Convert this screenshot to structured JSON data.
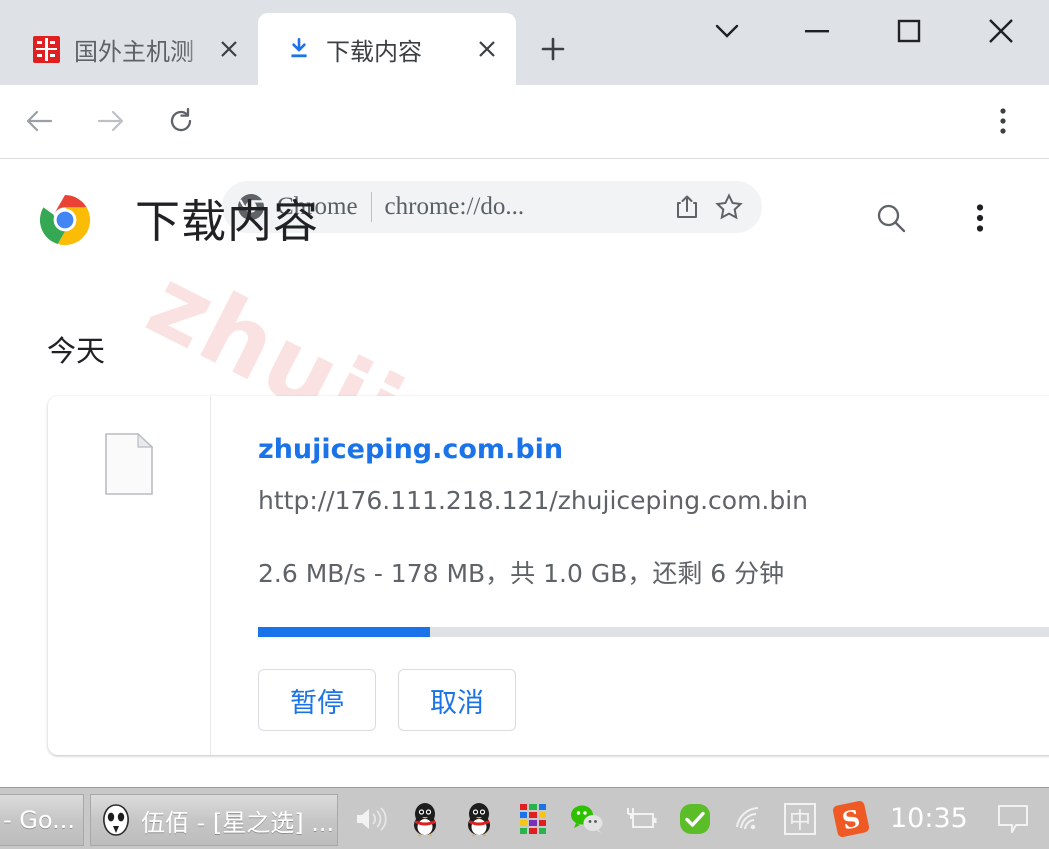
{
  "window": {
    "controls": [
      {
        "name": "tab-search",
        "glyph": "chevron-down"
      },
      {
        "name": "minimize",
        "glyph": "minus"
      },
      {
        "name": "maximize",
        "glyph": "square"
      },
      {
        "name": "close",
        "glyph": "x"
      }
    ]
  },
  "tabs": [
    {
      "title": "国外主机测",
      "icon": "seal-favicon",
      "active": false,
      "close_label": "✕"
    },
    {
      "title": "下载内容",
      "icon": "download-icon",
      "active": true,
      "close_label": "✕"
    }
  ],
  "newtab": {
    "label": "+"
  },
  "toolbar": {
    "back": "←",
    "forward": "→",
    "reload": "↻",
    "menu": "⋮",
    "omnibox": {
      "chip_label": "Chrome",
      "url_text": "chrome://do...",
      "share_icon": "share-icon",
      "bookmark_icon": "star-icon"
    }
  },
  "page": {
    "title": "下载内容",
    "search_icon": "search-icon",
    "more_icon": "more-vert-icon",
    "day_label": "今天",
    "watermark": "zhujiceping.com",
    "download": {
      "filename": "zhujiceping.com.bin",
      "url": "http://176.111.218.121/zhujiceping.com.bin",
      "status": "2.6 MB/s - 178 MB，共 1.0 GB，还剩 6 分钟",
      "progress_percent": 21,
      "buttons": [
        {
          "label": "暂停",
          "name": "pause-button"
        },
        {
          "label": "取消",
          "name": "cancel-button"
        }
      ]
    }
  },
  "taskbar": {
    "tasks": [
      {
        "label": "- Go...",
        "name": "taskbar-item-chrome"
      },
      {
        "label": "伍佰 - [星之选] ...",
        "name": "taskbar-item-foobar2000"
      }
    ],
    "tray": [
      {
        "name": "volume-icon"
      },
      {
        "name": "qq-icon"
      },
      {
        "name": "qq-icon-2"
      },
      {
        "name": "color-grid-icon"
      },
      {
        "name": "wechat-icon"
      },
      {
        "name": "battery-icon"
      },
      {
        "name": "security-check-icon"
      },
      {
        "name": "wifi-icon"
      },
      {
        "name": "ime-icon",
        "glyph": "中"
      },
      {
        "name": "sogou-icon",
        "glyph": "S"
      }
    ],
    "clock": "10:35",
    "notification_icon": "notification-icon"
  },
  "colors": {
    "accent_blue": "#1a73e8",
    "tabstrip_bg": "#dee1e6",
    "omnibox_bg": "#f1f3f4",
    "taskbar_bg": "#c8c8c8",
    "watermark_pink": "#f6baba"
  }
}
